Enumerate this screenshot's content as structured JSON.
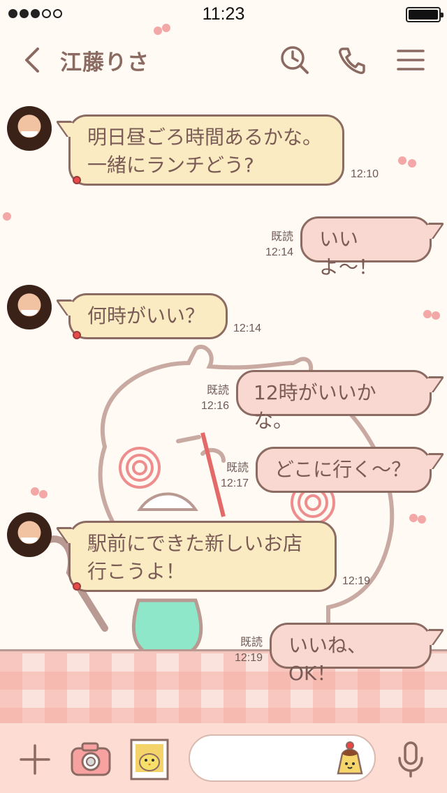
{
  "status_bar": {
    "time": "11:23",
    "signal_bars_filled": 3,
    "signal_bars_total": 5,
    "battery_level": 1.0
  },
  "header": {
    "contact_name": "江藤りさ",
    "icons": [
      "back-icon",
      "search-history-icon",
      "phone-icon",
      "menu-icon"
    ]
  },
  "messages": [
    {
      "direction": "incoming",
      "text": "明日昼ごろ時間あるかな。\n一緒にランチどう?",
      "time": "12:10"
    },
    {
      "direction": "outgoing",
      "text": "いいよ〜！",
      "read": "既読",
      "time": "12:14"
    },
    {
      "direction": "incoming",
      "text": "何時がいい？",
      "time": "12:14"
    },
    {
      "direction": "outgoing",
      "text": "12時がいいかな。",
      "read": "既読",
      "time": "12:16"
    },
    {
      "direction": "outgoing",
      "text": "どこに行く〜？",
      "read": "既読",
      "time": "12:17"
    },
    {
      "direction": "incoming",
      "text": "駅前にできた新しいお店\n行こうよ！",
      "time": "12:19"
    },
    {
      "direction": "outgoing",
      "text": "いいね、OK！",
      "read": "既読",
      "time": "12:19"
    }
  ],
  "toolbar": {
    "input_value": "",
    "icons": [
      "plus-icon",
      "camera-icon",
      "photo-icon",
      "sticker-icon",
      "mic-icon"
    ]
  },
  "colors": {
    "background": "#fffaf3",
    "incoming_bubble": "#fbebc2",
    "outgoing_bubble": "#f8d8d0",
    "bubble_border": "#8c6b63",
    "toolbar": "#fcdcd3",
    "header_text": "#8b6a62"
  }
}
